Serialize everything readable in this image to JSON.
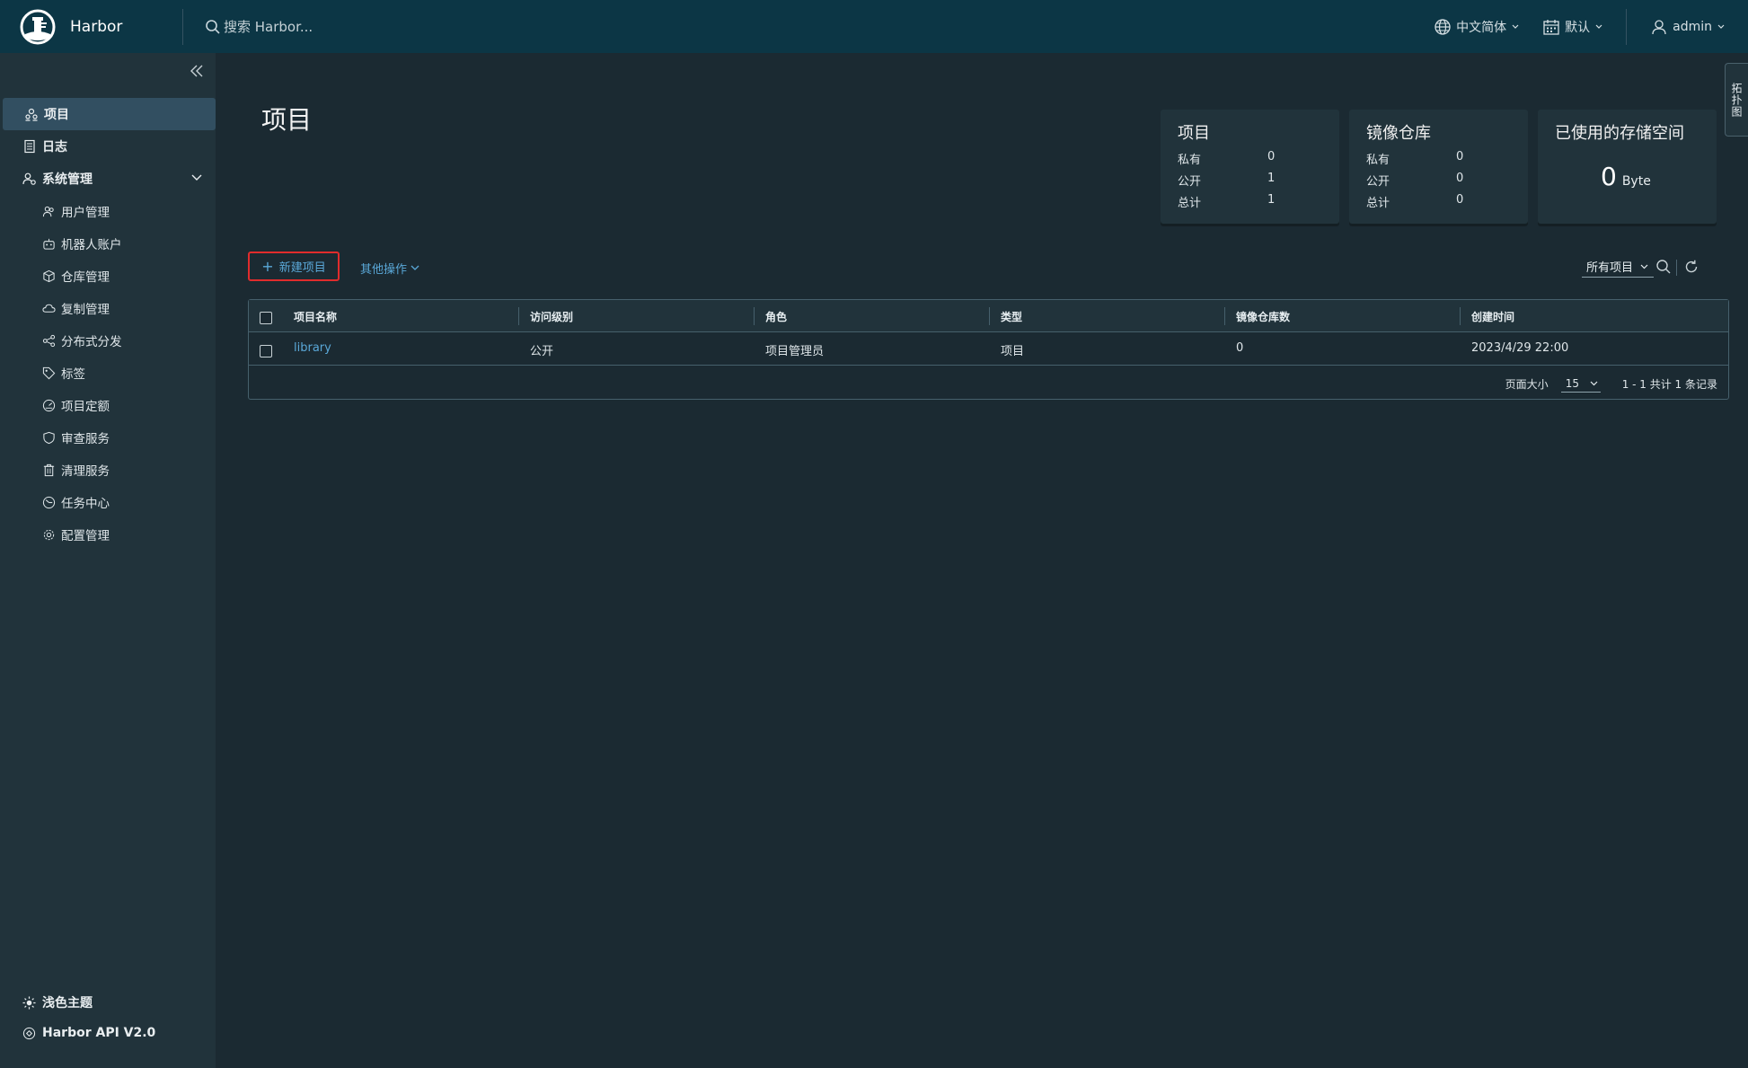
{
  "header": {
    "app_title": "Harbor",
    "search_placeholder": "搜索 Harbor...",
    "language": "中文简体",
    "datetime_format": "默认",
    "user": "admin"
  },
  "sidebar": {
    "items": [
      {
        "label": "项目"
      },
      {
        "label": "日志"
      },
      {
        "label": "系统管理"
      },
      {
        "label": "用户管理"
      },
      {
        "label": "机器人账户"
      },
      {
        "label": "仓库管理"
      },
      {
        "label": "复制管理"
      },
      {
        "label": "分布式分发"
      },
      {
        "label": "标签"
      },
      {
        "label": "项目定额"
      },
      {
        "label": "审查服务"
      },
      {
        "label": "清理服务"
      },
      {
        "label": "任务中心"
      },
      {
        "label": "配置管理"
      }
    ],
    "footer": {
      "theme": "浅色主题",
      "api": "Harbor API V2.0"
    }
  },
  "main": {
    "title": "项目",
    "cards": {
      "projects": {
        "title": "项目",
        "rows": [
          {
            "label": "私有",
            "value": "0"
          },
          {
            "label": "公开",
            "value": "1"
          },
          {
            "label": "总计",
            "value": "1"
          }
        ]
      },
      "repositories": {
        "title": "镜像仓库",
        "rows": [
          {
            "label": "私有",
            "value": "0"
          },
          {
            "label": "公开",
            "value": "0"
          },
          {
            "label": "总计",
            "value": "0"
          }
        ]
      },
      "storage": {
        "title": "已使用的存储空间",
        "value": "0",
        "unit": "Byte"
      }
    },
    "toolbar": {
      "new_project": "新建项目",
      "other_actions": "其他操作",
      "filter": "所有项目"
    },
    "table": {
      "columns": [
        "项目名称",
        "访问级别",
        "角色",
        "类型",
        "镜像仓库数",
        "创建时间"
      ],
      "rows": [
        {
          "name": "library",
          "access": "公开",
          "role": "项目管理员",
          "type": "项目",
          "repo_count": "0",
          "created": "2023/4/29 22:00"
        }
      ],
      "footer": {
        "page_size_label": "页面大小",
        "page_size": "15",
        "page_info": "1 - 1 共计 1 条记录"
      }
    }
  },
  "side_tab": {
    "label": "拓扑图"
  }
}
